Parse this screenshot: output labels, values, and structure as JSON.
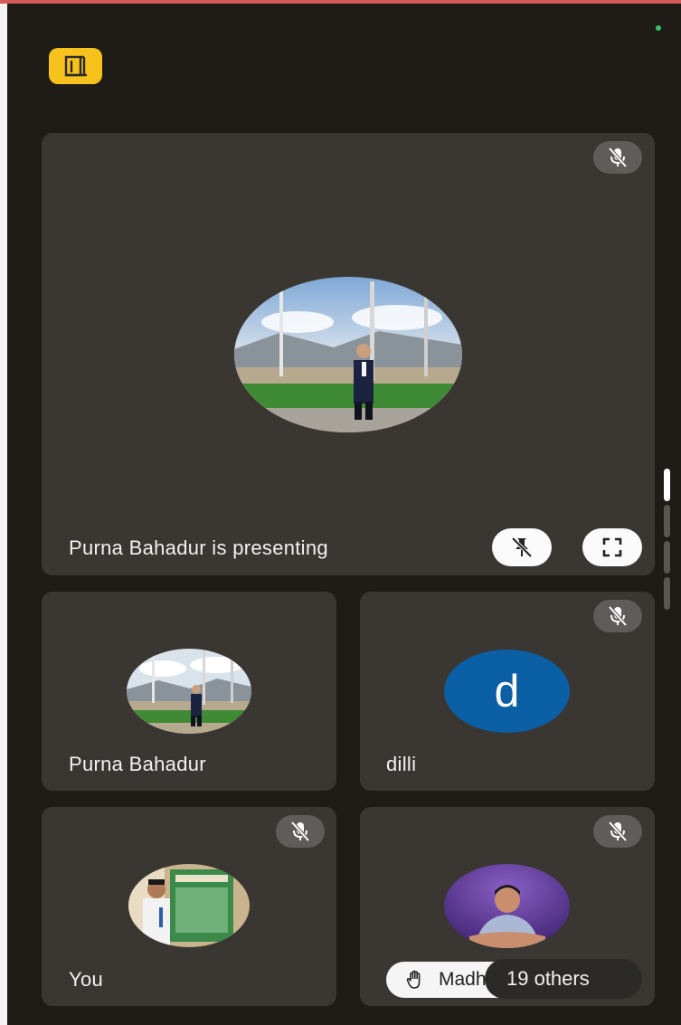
{
  "colors": {
    "background": "#1f1c18",
    "tile": "#3a3632",
    "leave_button": "#f7c21b",
    "letter_avatar": "#0b5fa5",
    "mic_badge": "#5f5c5a"
  },
  "header": {
    "leave_icon": "door-exit-icon",
    "status_dot": "green-dot"
  },
  "main_tile": {
    "caption": "Purna Bahadur is presenting",
    "mic_icon": "mic-off-icon",
    "pin_icon": "unpin-icon",
    "fullscreen_icon": "fullscreen-icon"
  },
  "participants": [
    {
      "name": "Purna Bahadur",
      "avatar": "photo"
    },
    {
      "name": "dilli",
      "avatar_letter": "d",
      "mic_icon": "mic-off-icon"
    },
    {
      "name": "You",
      "avatar": "photo",
      "mic_icon": "mic-off-icon"
    },
    {
      "name": "Madhav",
      "avatar": "photo",
      "mic_icon": "mic-off-icon"
    }
  ],
  "raised_hand": {
    "icon": "raised-hand-icon",
    "label": "Madhav"
  },
  "others_chip": {
    "label": "19 others"
  }
}
